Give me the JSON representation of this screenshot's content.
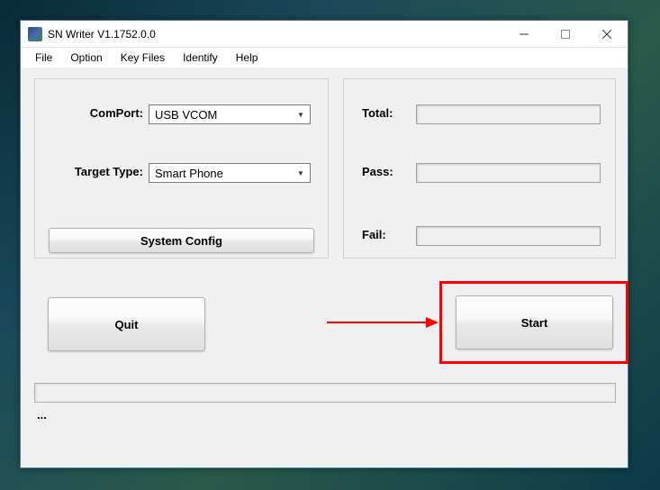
{
  "window": {
    "title": "SN Writer V1.1752.0.0"
  },
  "menu": {
    "file": "File",
    "option": "Option",
    "keyfiles": "Key Files",
    "identify": "Identify",
    "help": "Help"
  },
  "left_panel": {
    "comport_label": "ComPort:",
    "comport_value": "USB VCOM",
    "target_label": "Target Type:",
    "target_value": "Smart Phone",
    "sysconfig_label": "System Config"
  },
  "right_panel": {
    "total_label": "Total:",
    "total_value": "",
    "pass_label": "Pass:",
    "pass_value": "",
    "fail_label": "Fail:",
    "fail_value": ""
  },
  "buttons": {
    "quit": "Quit",
    "start": "Start"
  },
  "status": "...",
  "annotation": {
    "highlight_color": "#ff0000",
    "arrow_color": "#ff0000"
  }
}
